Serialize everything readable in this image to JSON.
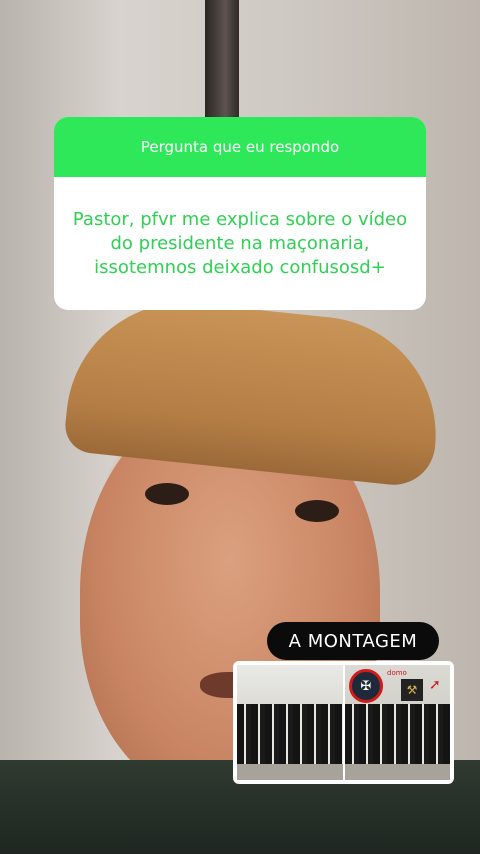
{
  "question_box": {
    "header": "Pergunta que eu respondo",
    "text": "Pastor, pfvr me explica sobre o vídeo do presidente na maçonaria, issotemnos deixado confusosd+"
  },
  "overlay": {
    "label": "A MONTAGEM"
  },
  "photo_card": {
    "emblem_text": "domo",
    "icons": [
      "masonic-emblem-icon",
      "masonic-square-icon",
      "arrow-icon"
    ]
  },
  "colors": {
    "header_green": "#2ee85a",
    "question_text_green": "#2ed151",
    "label_bg": "#0b0b0b",
    "highlight_red": "#d11a1a"
  }
}
